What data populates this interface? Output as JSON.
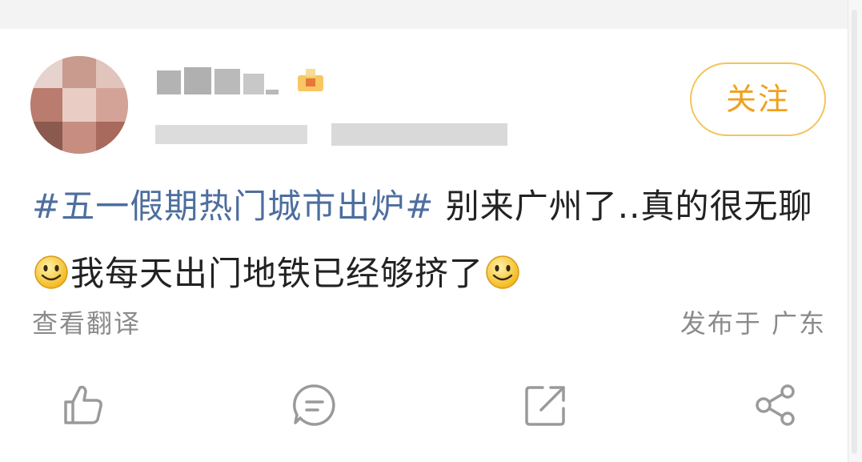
{
  "post": {
    "follow_label": "关注",
    "topic": "#五一假期热门城市出炉#",
    "text_part1": " 别来广州了..真的很无聊",
    "text_part2": "我每天出门地铁已经够挤了",
    "translate_label": "查看翻译",
    "location_label": "发布于 广东"
  },
  "icons": {
    "avatar": "avatar-blurred",
    "crown": "vip-crown-icon",
    "smiley": "smiley-emoji",
    "like": "thumbs-up-icon",
    "comment": "comment-bubble-icon",
    "repost": "repost-icon",
    "share": "share-icon"
  },
  "colors": {
    "topic": "#4d6e9e",
    "follow_text": "#f0a01e",
    "follow_border": "#f2c55a",
    "secondary_text": "#8b8b8b",
    "icon_stroke": "#9a9a9a"
  }
}
